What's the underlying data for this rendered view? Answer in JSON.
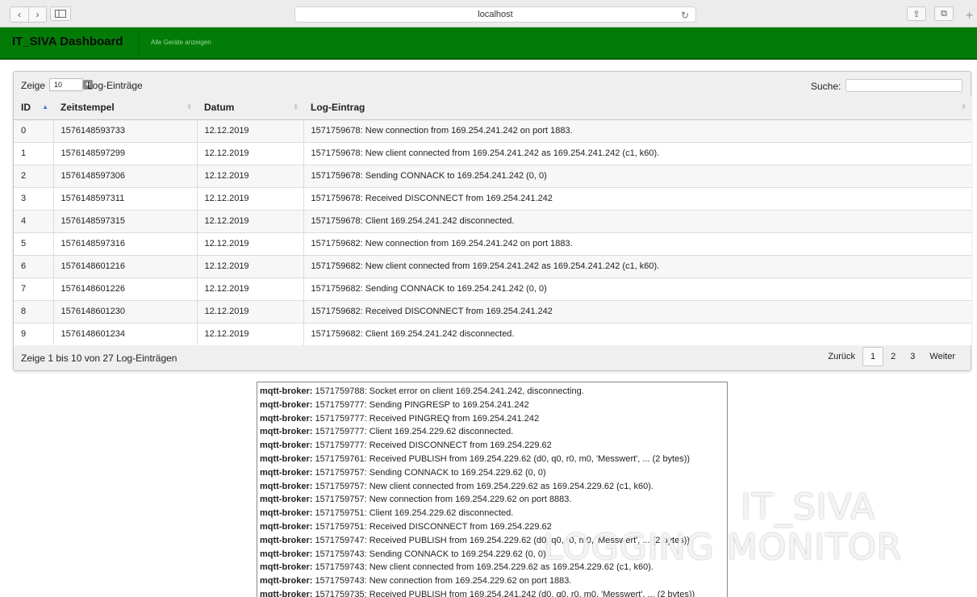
{
  "browser": {
    "back": "‹",
    "forward": "›",
    "url": "localhost",
    "reload": "↻",
    "share": "⇪",
    "tabs": "⧉",
    "new_tab": "+"
  },
  "navbar": {
    "brand": "IT_SIVA Dashboard",
    "link": "Alle Geräte anzeigen",
    "color": "#037c07"
  },
  "table_controls": {
    "show_prefix": "Zeige",
    "page_size": "10",
    "show_suffix": "Log-Einträge",
    "search_label": "Suche:",
    "search_value": ""
  },
  "table": {
    "columns": [
      "ID",
      "Zeitstempel",
      "Datum",
      "Log-Eintrag"
    ],
    "rows": [
      [
        "0",
        "1576148593733",
        "12.12.2019",
        "1571759678: New connection from 169.254.241.242 on port 1883."
      ],
      [
        "1",
        "1576148597299",
        "12.12.2019",
        "1571759678: New client connected from 169.254.241.242 as 169.254.241.242 (c1, k60)."
      ],
      [
        "2",
        "1576148597306",
        "12.12.2019",
        "1571759678: Sending CONNACK to 169.254.241.242 (0, 0)"
      ],
      [
        "3",
        "1576148597311",
        "12.12.2019",
        "1571759678: Received DISCONNECT from 169.254.241.242"
      ],
      [
        "4",
        "1576148597315",
        "12.12.2019",
        "1571759678: Client 169.254.241.242 disconnected."
      ],
      [
        "5",
        "1576148597316",
        "12.12.2019",
        "1571759682: New connection from 169.254.241.242 on port 1883."
      ],
      [
        "6",
        "1576148601216",
        "12.12.2019",
        "1571759682: New client connected from 169.254.241.242 as 169.254.241.242 (c1, k60)."
      ],
      [
        "7",
        "1576148601226",
        "12.12.2019",
        "1571759682: Sending CONNACK to 169.254.241.242 (0, 0)"
      ],
      [
        "8",
        "1576148601230",
        "12.12.2019",
        "1571759682: Received DISCONNECT from 169.254.241.242"
      ],
      [
        "9",
        "1576148601234",
        "12.12.2019",
        "1571759682: Client 169.254.241.242 disconnected."
      ]
    ]
  },
  "table_footer": {
    "info": "Zeige 1 bis 10 von 27 Log-Einträgen",
    "prev": "Zurück",
    "pages": [
      "1",
      "2",
      "3"
    ],
    "current_page": "1",
    "next": "Weiter"
  },
  "console": {
    "prefix": "mqtt-broker:",
    "lines": [
      "1571759788: Socket error on client 169.254.241.242, disconnecting.",
      "1571759777: Sending PINGRESP to 169.254.241.242",
      "1571759777: Received PINGREQ from 169.254.241.242",
      "1571759777: Client 169.254.229.62 disconnected.",
      "1571759777: Received DISCONNECT from 169.254.229.62",
      "1571759761: Received PUBLISH from 169.254.229.62 (d0, q0, r0, m0, 'Messwert', ... (2 bytes))",
      "1571759757: Sending CONNACK to 169.254.229.62 (0, 0)",
      "1571759757: New client connected from 169.254.229.62 as 169.254.229.62 (c1, k60).",
      "1571759757: New connection from 169.254.229.62 on port 8883.",
      "1571759751: Client 169.254.229.62 disconnected.",
      "1571759751: Received DISCONNECT from 169.254.229.62",
      "1571759747: Received PUBLISH from 169.254.229.62 (d0, q0, r0, m0, 'Messwert', ... (2 bytes))",
      "1571759743: Sending CONNACK to 169.254.229.62 (0, 0)",
      "1571759743: New client connected from 169.254.229.62 as 169.254.229.62 (c1, k60).",
      "1571759743: New connection from 169.254.229.62 on port 1883.",
      "1571759735: Received PUBLISH from 169.254.241.242 (d0, q0, r0, m0, 'Messwert', ... (2 bytes))"
    ]
  },
  "watermark": {
    "line1": "IT_SIVA",
    "line2": "LOGGING MONITOR"
  }
}
